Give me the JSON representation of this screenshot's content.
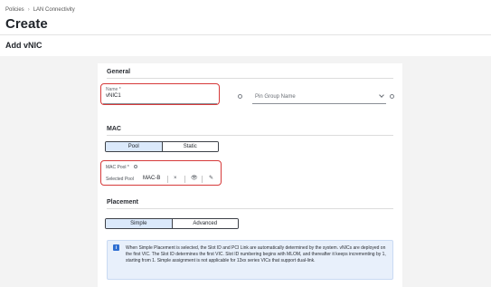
{
  "breadcrumb": {
    "items": [
      "Policies",
      "LAN Connectivity"
    ],
    "separator": "›"
  },
  "page": {
    "title": "Create",
    "section_title": "Add vNIC"
  },
  "general": {
    "heading": "General",
    "name_label": "Name *",
    "name_value": "vNIC1",
    "pin_group_placeholder": "Pin Group Name"
  },
  "mac": {
    "heading": "MAC",
    "options": [
      "Pool",
      "Static"
    ],
    "selected": "Pool",
    "pool_label": "MAC Pool *",
    "selected_pool_label": "Selected Pool",
    "selected_pool_value": "MAC-B",
    "clear_glyph": "×",
    "view_glyph": "👁",
    "edit_glyph": "✎"
  },
  "placement": {
    "heading": "Placement",
    "options": [
      "Simple",
      "Advanced"
    ],
    "selected": "Simple",
    "info_glyph": "i",
    "info_text": "When Simple Placement is selected, the Slot ID and PCI Link are automatically determined by the system. vNICs are deployed on the first VIC. The Slot ID determines the first VIC. Slot ID numbering begins with MLOM, and thereafter it keeps incrementing by 1, starting from 1. Simple assignment is not applicable for 13xx series VICs that support dual-link."
  },
  "colors": {
    "accent": "#2f6fd1",
    "highlight": "#d63a3a",
    "selected_bg": "#dbe9fb",
    "info_bg": "#e8f0fb"
  }
}
